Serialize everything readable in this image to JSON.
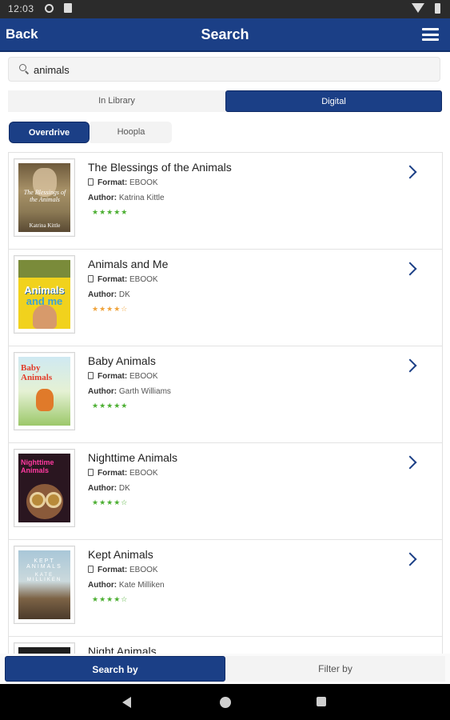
{
  "status_bar": {
    "time": "12:03"
  },
  "app_bar": {
    "back_label": "Back",
    "title": "Search"
  },
  "search": {
    "value": "animals"
  },
  "source_toggle": {
    "in_library": "In Library",
    "digital": "Digital"
  },
  "provider_toggle": {
    "overdrive": "Overdrive",
    "hoopla": "Hoopla"
  },
  "labels": {
    "format": "Format:",
    "author": "Author:"
  },
  "results": [
    {
      "title": "The Blessings of the Animals",
      "format": "EBOOK",
      "author": "Katrina Kittle",
      "stars": "★★★★★",
      "star_color": "#4caf32",
      "cover_text": "The Blessings of the Animals",
      "cover_author": "Katrina Kittle"
    },
    {
      "title": "Animals and Me",
      "format": "EBOOK",
      "author": "DK",
      "stars": "★★★★☆",
      "star_color": "#f0a33a",
      "cover_text": "Animals",
      "cover_text2": "and me"
    },
    {
      "title": "Baby Animals",
      "format": "EBOOK",
      "author": "Garth Williams",
      "stars": "★★★★★",
      "star_color": "#4caf32",
      "cover_text": "Baby Animals"
    },
    {
      "title": "Nighttime Animals",
      "format": "EBOOK",
      "author": "DK",
      "stars": "★★★★☆",
      "star_color": "#4caf32",
      "cover_text": "Nighttime Animals"
    },
    {
      "title": "Kept Animals",
      "format": "EBOOK",
      "author": "Kate Milliken",
      "stars": "★★★★☆",
      "star_color": "#4caf32",
      "cover_text": "KEPT ANIMALS",
      "cover_author": "KATE MILLIKEN"
    },
    {
      "title": "Night Animals"
    }
  ],
  "bottom_tabs": {
    "search_by": "Search by",
    "filter_by": "Filter by"
  },
  "colors": {
    "primary": "#1b3f86",
    "star_green": "#4caf32",
    "star_orange": "#f0a33a"
  }
}
